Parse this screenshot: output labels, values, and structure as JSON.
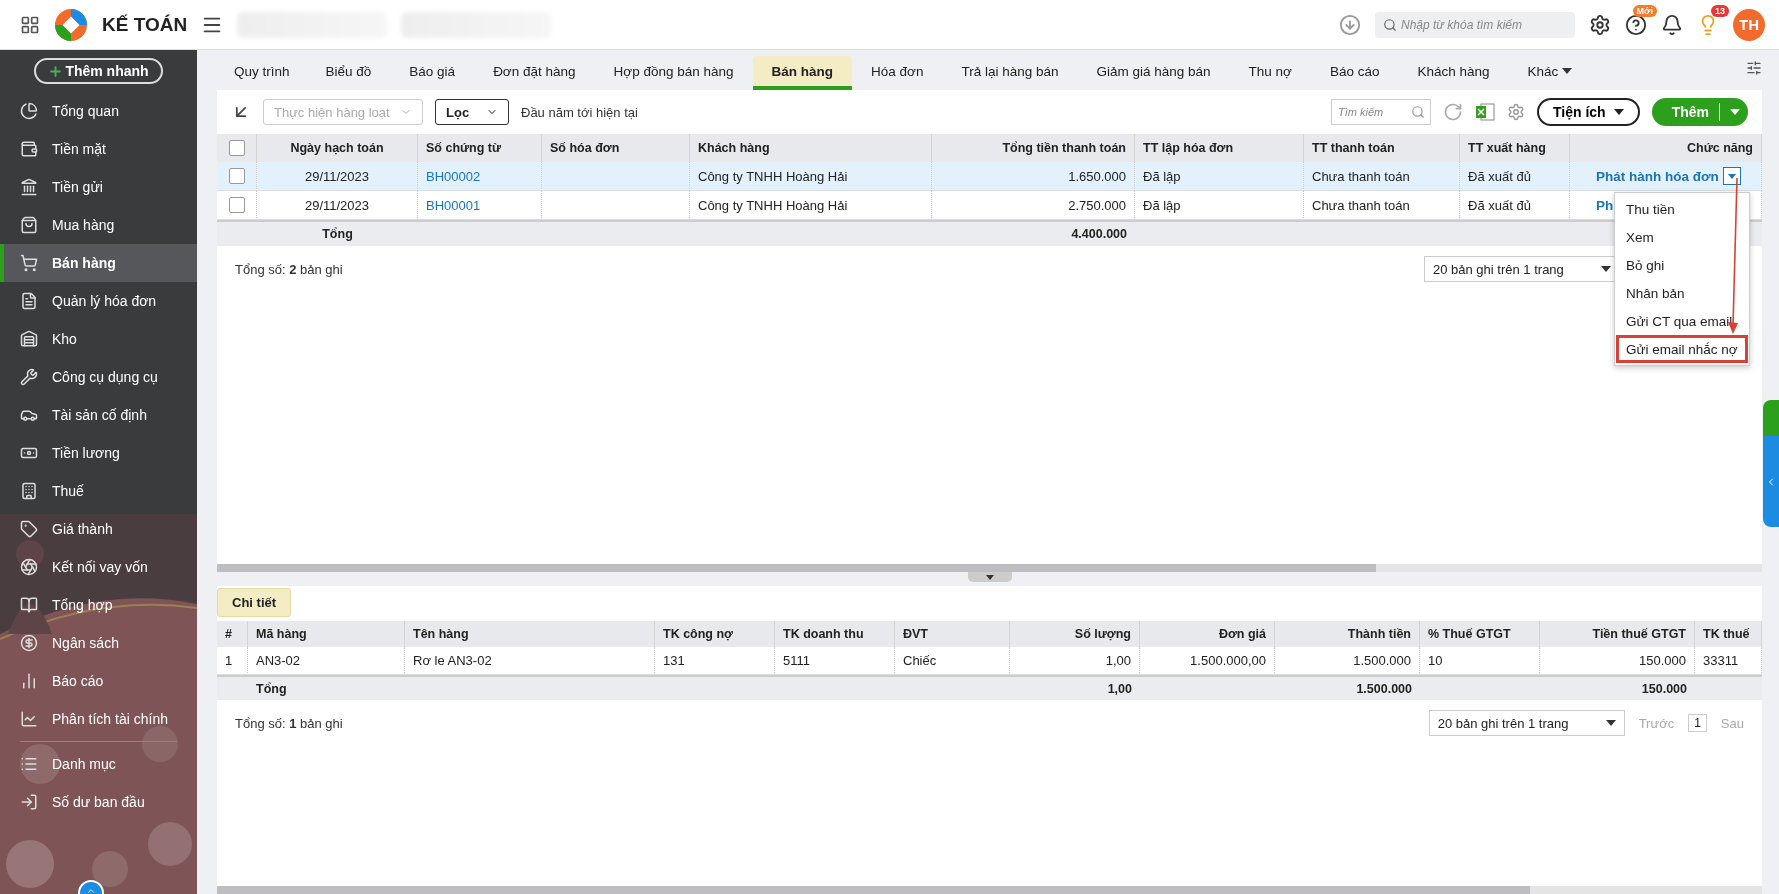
{
  "topbar": {
    "app_name": "KẾ TOÁN",
    "search": {
      "placeholder": "Nhập từ khóa tìm kiếm"
    },
    "help_badge": "Mới",
    "tips_badge": "13",
    "avatar": "TH"
  },
  "sidebar": {
    "quick_add": "Thêm nhanh",
    "items": [
      {
        "label": "Tổng quan",
        "selected": false
      },
      {
        "label": "Tiền mặt",
        "selected": false
      },
      {
        "label": "Tiền gửi",
        "selected": false
      },
      {
        "label": "Mua hàng",
        "selected": false
      },
      {
        "label": "Bán hàng",
        "selected": true
      },
      {
        "label": "Quản lý hóa đơn",
        "selected": false
      },
      {
        "label": "Kho",
        "selected": false
      },
      {
        "label": "Công cụ dụng cụ",
        "selected": false
      },
      {
        "label": "Tài sản cố định",
        "selected": false
      },
      {
        "label": "Tiền lương",
        "selected": false
      },
      {
        "label": "Thuế",
        "selected": false
      },
      {
        "label": "Giá thành",
        "selected": false
      },
      {
        "label": "Kết nối vay vốn",
        "selected": false
      },
      {
        "label": "Tổng hợp",
        "selected": false
      },
      {
        "label": "Ngân sách",
        "selected": false
      },
      {
        "label": "Báo cáo",
        "selected": false
      },
      {
        "label": "Phân tích tài chính",
        "selected": false
      },
      {
        "label": "Danh mục",
        "selected": false,
        "kind": "after-divider"
      },
      {
        "label": "Số dư ban đầu",
        "selected": false
      }
    ]
  },
  "tabs": [
    {
      "label": "Quy trình",
      "selected": false
    },
    {
      "label": "Biểu đồ",
      "selected": false
    },
    {
      "label": "Báo giá",
      "selected": false
    },
    {
      "label": "Đơn đặt hàng",
      "selected": false
    },
    {
      "label": "Hợp đồng bán hàng",
      "selected": false
    },
    {
      "label": "Bán hàng",
      "selected": true
    },
    {
      "label": "Hóa đơn",
      "selected": false
    },
    {
      "label": "Trả lại hàng bán",
      "selected": false
    },
    {
      "label": "Giảm giá hàng bán",
      "selected": false
    },
    {
      "label": "Thu nợ",
      "selected": false
    },
    {
      "label": "Báo cáo",
      "selected": false
    },
    {
      "label": "Khách hàng",
      "selected": false
    },
    {
      "label": "Khác",
      "selected": false,
      "kind": "more"
    }
  ],
  "toolbar": {
    "batch_action": {
      "label": "Thực hiện hàng loạt",
      "disabled": true
    },
    "filter": "Lọc",
    "period": "Đầu năm tới hiện tại",
    "search": {
      "placeholder": "Tìm kiếm"
    },
    "utilities": "Tiện ích",
    "add": "Thêm"
  },
  "table": {
    "header_checked": false,
    "columns": [
      "Ngày hạch toán",
      "Số chứng từ",
      "Số hóa đơn",
      "Khách hàng",
      "Tổng tiền thanh toán",
      "TT lập hóa đơn",
      "TT thanh toán",
      "TT xuất hàng",
      "Chức năng"
    ],
    "rows": [
      {
        "selected": true,
        "checked": false,
        "date": "29/11/2023",
        "voucher_no": "BH00002",
        "customer": "Công ty TNHH Hoàng Hải",
        "total": "1.650.000",
        "invoice_status": "Đã lập",
        "payment_status": "Chưa thanh toán",
        "delivery_status": "Đã xuất đủ",
        "action": "Phát hành hóa đơn",
        "menu_expanded": true
      },
      {
        "selected": false,
        "checked": false,
        "date": "29/11/2023",
        "voucher_no": "BH00001",
        "customer": "Công ty TNHH Hoàng Hải",
        "total": "2.750.000",
        "invoice_status": "Đã lập",
        "payment_status": "Chưa thanh toán",
        "delivery_status": "Đã xuất đủ",
        "action": "Ph",
        "menu_expanded": false
      }
    ],
    "totals": {
      "label": "Tổng",
      "total": "4.400.000"
    },
    "record_count": "Tổng số: **2** bản ghi",
    "page_size": "20 bản ghi trên 1 trang"
  },
  "action_menu": {
    "items": [
      {
        "label": "Thu tiền",
        "highlighted": false
      },
      {
        "label": "Xem",
        "highlighted": false
      },
      {
        "label": "Bỏ ghi",
        "highlighted": false
      },
      {
        "label": "Nhân bản",
        "highlighted": false
      },
      {
        "label": "Gửi CT qua email",
        "highlighted": false
      },
      {
        "label": "Gửi email nhắc nợ",
        "highlighted": true
      }
    ]
  },
  "detail": {
    "tab": "Chi tiết",
    "columns": [
      "#",
      "Mã hàng",
      "Tên hàng",
      "TK công nợ",
      "TK doanh thu",
      "ĐVT",
      "Số lượng",
      "Đơn giá",
      "Thành tiền",
      "% Thuế GTGT",
      "Tiền thuế GTGT",
      "TK thuế"
    ],
    "rows": [
      {
        "index": "1",
        "item_code": "AN3-02",
        "item_name": "Rơ le AN3-02",
        "receivable_account": "131",
        "revenue_account": "5111",
        "unit": "Chiếc",
        "quantity": "1,00",
        "unit_price": "1.500.000,00",
        "amount": "1.500.000",
        "vat_rate": "10",
        "vat_amount": "150.000",
        "vat_account": "33311"
      }
    ],
    "totals": {
      "label": "Tổng",
      "quantity": "1,00",
      "amount": "1.500.000",
      "vat_amount": "150.000"
    },
    "record_count": "Tổng số: **1** bản ghi",
    "page_size": "20 bản ghi trên 1 trang",
    "prev": "Trước",
    "page": "1",
    "next": "Sau"
  }
}
